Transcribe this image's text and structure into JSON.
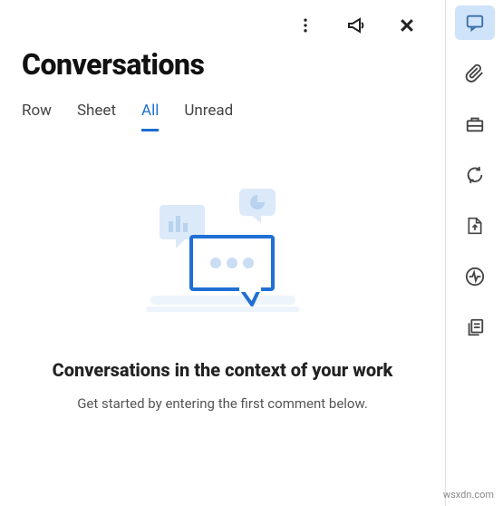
{
  "header": {
    "title": "Conversations"
  },
  "tabs": [
    {
      "label": "Row",
      "active": false
    },
    {
      "label": "Sheet",
      "active": false
    },
    {
      "label": "All",
      "active": true
    },
    {
      "label": "Unread",
      "active": false
    }
  ],
  "empty_state": {
    "title": "Conversations in the context of your work",
    "subtitle": "Get started by entering the first comment below."
  },
  "sidebar": {
    "items": [
      {
        "name": "conversations-icon",
        "active": true
      },
      {
        "name": "attachments-icon",
        "active": false
      },
      {
        "name": "briefcase-icon",
        "active": false
      },
      {
        "name": "refresh-icon",
        "active": false
      },
      {
        "name": "export-icon",
        "active": false
      },
      {
        "name": "activity-icon",
        "active": false
      },
      {
        "name": "copy-icon",
        "active": false
      }
    ]
  },
  "watermark": "wsxdn.com"
}
